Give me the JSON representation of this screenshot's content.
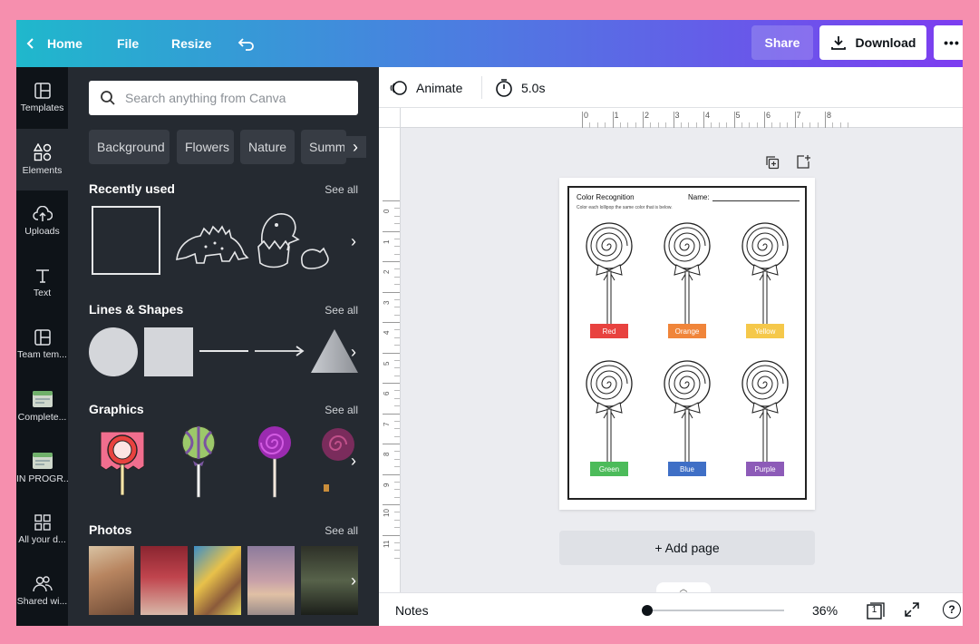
{
  "topbar": {
    "home_label": "Home",
    "file_label": "File",
    "resize_label": "Resize",
    "share_label": "Share",
    "download_label": "Download",
    "more_label": "•••"
  },
  "rail": {
    "items": [
      {
        "label": "Templates",
        "icon": "layout-icon"
      },
      {
        "label": "Elements",
        "icon": "shapes-icon"
      },
      {
        "label": "Uploads",
        "icon": "cloud-upload-icon"
      },
      {
        "label": "Text",
        "icon": "text-icon"
      },
      {
        "label": "Team tem...",
        "icon": "layout-icon"
      },
      {
        "label": "Complete...",
        "icon": "folder-icon"
      },
      {
        "label": "IN PROGR...",
        "icon": "folder-icon"
      },
      {
        "label": "All your d...",
        "icon": "grid-icon"
      },
      {
        "label": "Shared wi...",
        "icon": "people-icon"
      }
    ]
  },
  "panel": {
    "search_placeholder": "Search anything from Canva",
    "chips": [
      "Background",
      "Flowers",
      "Nature",
      "Summer"
    ],
    "see_all": "See all",
    "recently_used_title": "Recently used",
    "lines_shapes_title": "Lines & Shapes",
    "graphics_title": "Graphics",
    "photos_title": "Photos"
  },
  "editor": {
    "animate_label": "Animate",
    "duration_label": "5.0s",
    "ruler_h": [
      "0",
      "1",
      "2",
      "3",
      "4",
      "5",
      "6",
      "7",
      "8"
    ],
    "ruler_v": [
      "0",
      "1",
      "2",
      "3",
      "4",
      "5",
      "6",
      "7",
      "8",
      "9",
      "10",
      "11"
    ],
    "add_page_label": "+ Add page"
  },
  "worksheet": {
    "title": "Color Recognition",
    "name_label": "Name:",
    "subtitle": "Color each lollipop the same color that is below.",
    "labels": [
      {
        "text": "Red",
        "color": "#e8423f"
      },
      {
        "text": "Orange",
        "color": "#f0853a"
      },
      {
        "text": "Yellow",
        "color": "#f5c84a"
      },
      {
        "text": "Green",
        "color": "#4cbb5a"
      },
      {
        "text": "Blue",
        "color": "#3f6fc6"
      },
      {
        "text": "Purple",
        "color": "#8d5bb8"
      }
    ]
  },
  "bottombar": {
    "notes_label": "Notes",
    "zoom_label": "36%",
    "page_count": "1",
    "help_label": "?"
  },
  "colors": {
    "border_pink": "#f68fae",
    "panel_bg": "#252a31",
    "rail_bg": "#0e1318"
  }
}
